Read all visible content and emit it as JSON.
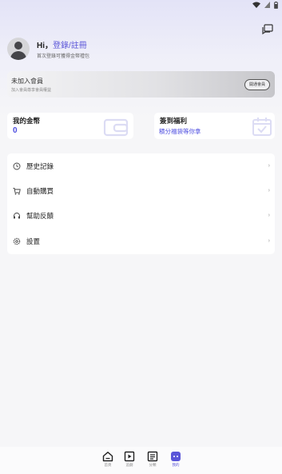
{
  "status_bar": {
    "icons": [
      "wifi-icon",
      "sim-icon",
      "battery-icon"
    ]
  },
  "header": {
    "message_icon": "message-icon"
  },
  "profile": {
    "greeting": "Hi，",
    "login_link": "登錄/註冊",
    "subtitle": "首次登錄可獲得金幣禮包"
  },
  "vip": {
    "title": "未加入會員",
    "subtitle": "加入會員尊享會員權益",
    "button": "開通會員"
  },
  "cards": {
    "coins": {
      "title": "我的金幣",
      "value": "0"
    },
    "sign_in": {
      "title": "簽到福利",
      "desc": "積分福袋等你拿"
    }
  },
  "menu": [
    {
      "label": "歷史記錄",
      "icon": "history-icon"
    },
    {
      "label": "自動購買",
      "icon": "cart-icon"
    },
    {
      "label": "幫助反饋",
      "icon": "headphones-icon"
    },
    {
      "label": "設置",
      "icon": "settings-icon"
    }
  ],
  "tabs": [
    {
      "label": "首頁",
      "icon": "home-icon"
    },
    {
      "label": "追劇",
      "icon": "play-icon"
    },
    {
      "label": "分類",
      "icon": "list-icon"
    },
    {
      "label": "我的",
      "icon": "profile-icon",
      "active": true
    }
  ],
  "colors": {
    "accent": "#5a55d8",
    "value": "#4e4ee0",
    "background": "#f6f6f8"
  }
}
